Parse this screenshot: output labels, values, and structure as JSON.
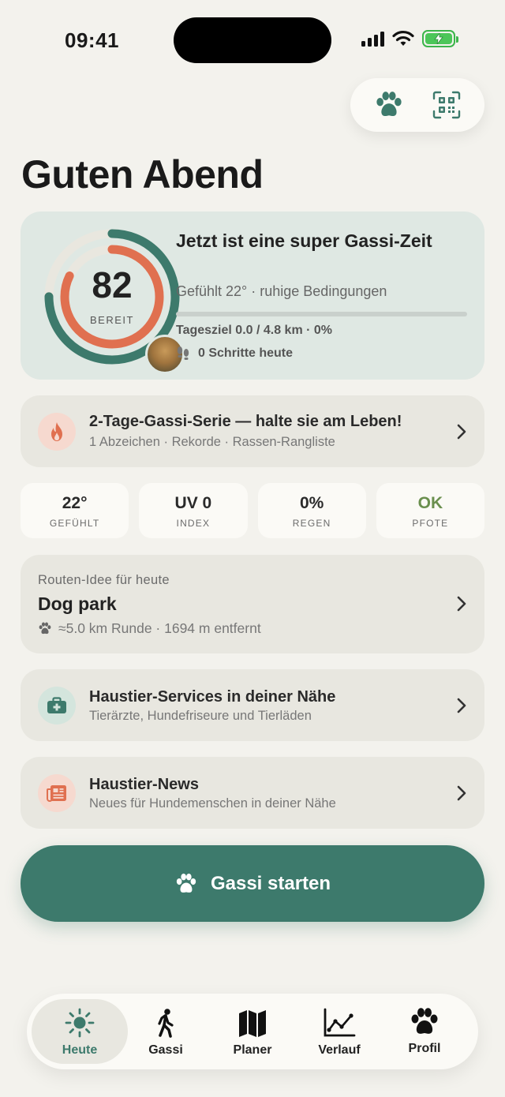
{
  "status": {
    "time": "09:41"
  },
  "greeting": "Guten Abend",
  "readiness": {
    "score": "82",
    "score_label": "BEREIT",
    "title": "Jetzt ist eine super Gassi-Zeit",
    "subtitle": "Gefühlt 22° · ruhige Bedingungen",
    "goal": "Tagesziel 0.0 / 4.8 km · 0%",
    "goal_progress": 0,
    "steps": "0 Schritte heute"
  },
  "streak": {
    "title": "2-Tage-Gassi-Serie — halte sie am Leben!",
    "subtitle": "1 Abzeichen · Rekorde · Rassen-Rangliste"
  },
  "tiles": [
    {
      "value": "22°",
      "label": "GEFÜHLT"
    },
    {
      "value": "UV 0",
      "label": "INDEX"
    },
    {
      "value": "0%",
      "label": "REGEN"
    },
    {
      "value": "OK",
      "label": "PFOTE",
      "color": "#6a8f4e"
    }
  ],
  "route": {
    "kicker": "Routen-Idee für heute",
    "title": "Dog park",
    "meta": "≈5.0 km Runde · 1694 m entfernt"
  },
  "services": {
    "title": "Haustier-Services in deiner Nähe",
    "subtitle": "Tierärzte, Hundefriseure und Tierläden"
  },
  "news": {
    "title": "Haustier-News",
    "subtitle": "Neues für Hundemenschen in deiner Nähe"
  },
  "cta": {
    "label": "Gassi starten"
  },
  "tabs": [
    {
      "label": "Heute",
      "icon": "sun-icon"
    },
    {
      "label": "Gassi",
      "icon": "walking-icon"
    },
    {
      "label": "Planer",
      "icon": "map-icon"
    },
    {
      "label": "Verlauf",
      "icon": "chart-icon"
    },
    {
      "label": "Profil",
      "icon": "paw-icon"
    }
  ],
  "colors": {
    "accent": "#3d7a6c",
    "orange": "#e07050",
    "background": "#f3f2ed"
  }
}
